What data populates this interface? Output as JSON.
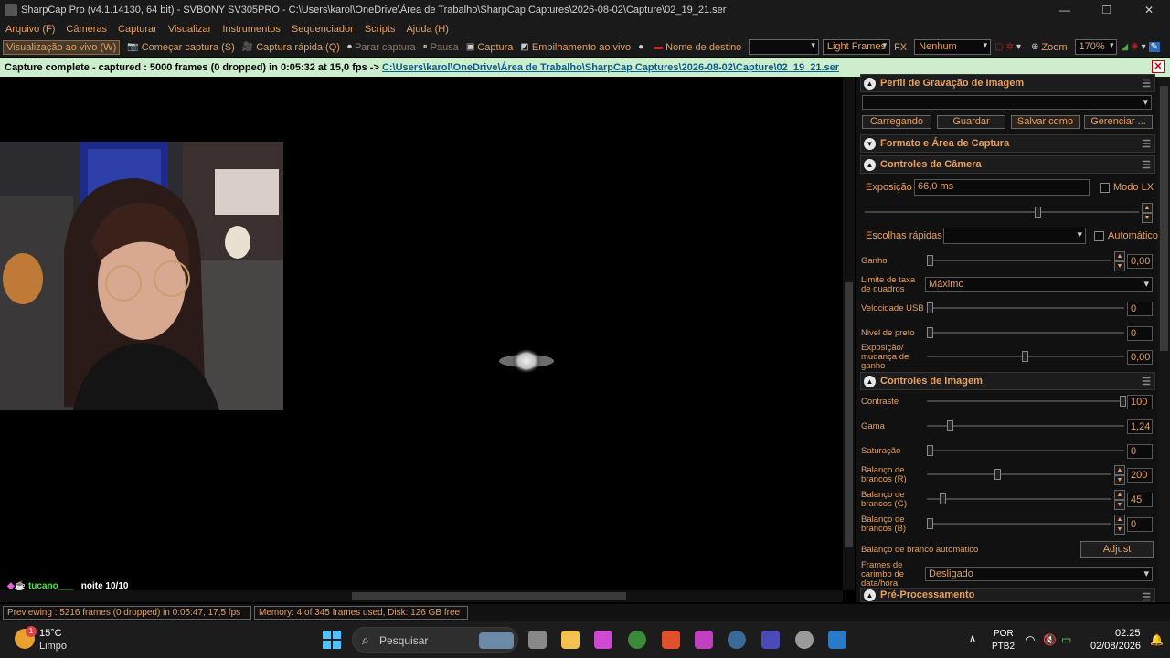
{
  "window": {
    "title": "SharpCap Pro (v4.1.14130, 64 bit) - SVBONY SV305PRO - C:\\Users\\karol\\OneDrive\\Área de Trabalho\\SharpCap Captures\\2026-08-02\\Capture\\02_19_21.ser"
  },
  "menu": [
    "Arquivo (F)",
    "Câmeras",
    "Capturar",
    "Visualizar",
    "Instrumentos",
    "Sequenciador",
    "Scripts",
    "Ajuda (H)"
  ],
  "toolbar": {
    "live_view": "Visualização ao vivo (W)",
    "start_capture": "Começar captura (S)",
    "quick_capture": "Captura rápida (Q)",
    "stop_capture": "Parar captura",
    "pause": "Pausa",
    "snapshot": "Captura",
    "live_stack": "Empilhamento ao vivo",
    "target_name": "Nome de destino",
    "target_value": "",
    "frame_type": "Light Frames",
    "fx_label": "FX",
    "fx_value": "Nenhum",
    "zoom_label": "Zoom",
    "zoom_value": "170%"
  },
  "notification": {
    "text": "Capture complete - captured : 5000 frames (0 dropped) in 0:05:32 at 15,0 fps  ->",
    "link_path": "C:\\Users\\karol\\OneDrive\\Área de Trabalho\\SharpCap Captures\\2026-08-02\\Capture\\",
    "link_file": "02_19_21.ser",
    "close": "✕"
  },
  "chat": {
    "user": "tucano___",
    "message": "noite 10/10"
  },
  "panel": {
    "profile_section": "Perfil de Gravação de Imagem",
    "profile_value": "",
    "profile_buttons": [
      "Carregando",
      "Guardar",
      "Salvar como ...",
      "Gerenciar ..."
    ],
    "format_section": "Formato e Área de Captura",
    "camera_section": "Controles da Câmera",
    "exposure_label": "Exposição",
    "exposure_value": "66,0 ms",
    "lx_mode": "Modo LX",
    "quick_picks": "Escolhas rápidas",
    "automatic": "Automático",
    "gain_label": "Ganho",
    "gain_value": "0,00",
    "framerate_label": "Limite de taxa de quadros",
    "framerate_value": "Máximo",
    "usb_label": "Velocidade USB",
    "usb_value": "0",
    "black_label": "Nivel de preto",
    "black_value": "0",
    "expgain_label": "Exposição/ mudança de ganho",
    "expgain_value": "0,00",
    "image_section": "Controles de Imagem",
    "contrast_label": "Contraste",
    "contrast_value": "100",
    "gamma_label": "Gama",
    "gamma_value": "1,24",
    "saturation_label": "Saturação",
    "saturation_value": "0",
    "wbr_label": "Balanço de brancos (R)",
    "wbr_value": "200",
    "wbg_label": "Balanço de brancos (G)",
    "wbg_value": "45",
    "wbb_label": "Balanço de brancos (B)",
    "wbb_value": "0",
    "autowb_label": "Balanço de branco automático",
    "adjust_button": "Adjust",
    "timestamp_label": "Frames de carimbo de data/hora",
    "timestamp_value": "Desligado",
    "preproc_section": "Pré-Processamento"
  },
  "status": {
    "preview": "Previewing : 5216 frames (0 dropped) in 0:05:47, 17,5 fps",
    "memory": "Memory: 4 of 345 frames used, Disk: 126 GB free"
  },
  "taskbar": {
    "temp": "15°C",
    "weather": "Limpo",
    "search": "Pesquisar",
    "lang1": "POR",
    "lang2": "PTB2",
    "time": "02:25",
    "date": "02/08/2026",
    "badge": "1"
  },
  "colors": {
    "accent": "#e8a060",
    "notify_bg": "#cdeecd",
    "link": "#0a5d8a"
  }
}
